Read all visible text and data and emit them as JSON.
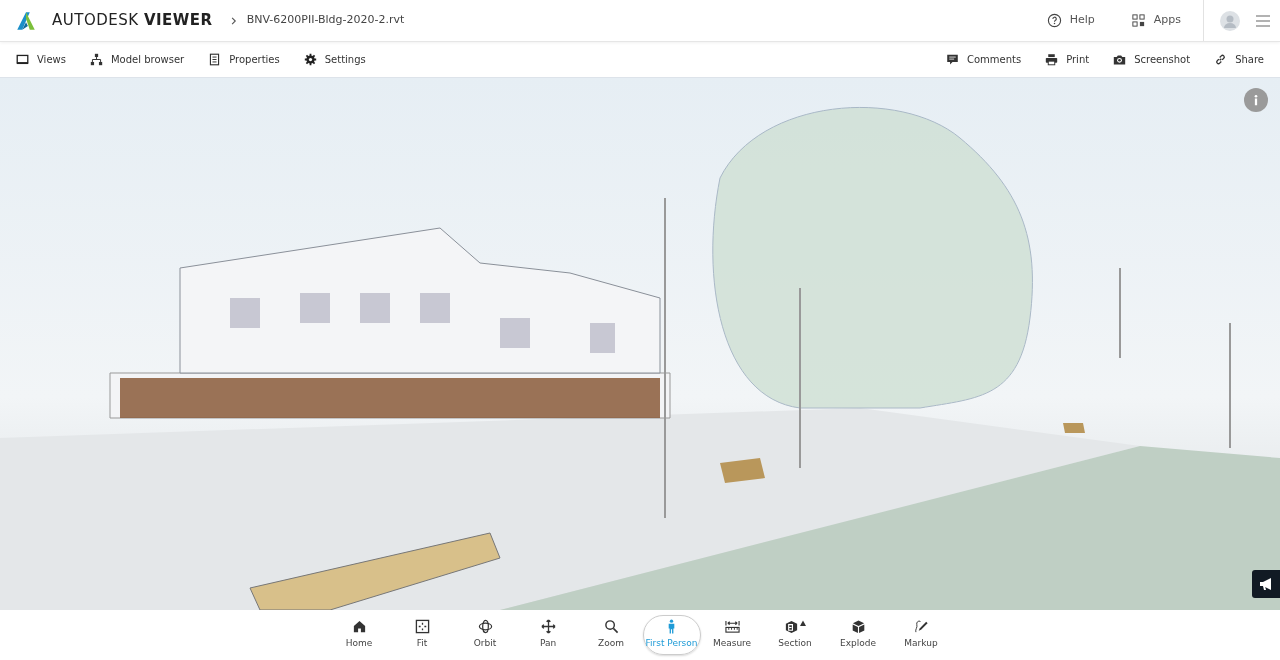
{
  "header": {
    "brand_light": "AUTODESK",
    "brand_bold": "VIEWER",
    "file_name": "BNV-6200PII-Bldg-2020-2.rvt",
    "links": [
      {
        "label": "Help",
        "kind": "help"
      },
      {
        "label": "Apps",
        "kind": "apps"
      }
    ]
  },
  "toolbar": {
    "left": [
      {
        "label": "Views",
        "kind": "views"
      },
      {
        "label": "Model browser",
        "kind": "tree"
      },
      {
        "label": "Properties",
        "kind": "properties"
      },
      {
        "label": "Settings",
        "kind": "settings"
      }
    ],
    "right": [
      {
        "label": "Comments",
        "kind": "comments"
      },
      {
        "label": "Print",
        "kind": "print"
      },
      {
        "label": "Screenshot",
        "kind": "camera"
      },
      {
        "label": "Share",
        "kind": "link"
      }
    ]
  },
  "tools": [
    {
      "label": "Home",
      "kind": "home",
      "selected": false
    },
    {
      "label": "Fit",
      "kind": "fit",
      "selected": false
    },
    {
      "label": "Orbit",
      "kind": "orbit",
      "selected": false
    },
    {
      "label": "Pan",
      "kind": "pan",
      "selected": false
    },
    {
      "label": "Zoom",
      "kind": "zoom",
      "selected": false
    },
    {
      "label": "First Person",
      "kind": "person",
      "selected": true
    },
    {
      "label": "Measure",
      "kind": "measure",
      "selected": false
    },
    {
      "label": "Section",
      "kind": "section",
      "selected": false
    },
    {
      "label": "Explode",
      "kind": "explode",
      "selected": false
    },
    {
      "label": "Markup",
      "kind": "markup",
      "selected": false
    }
  ]
}
